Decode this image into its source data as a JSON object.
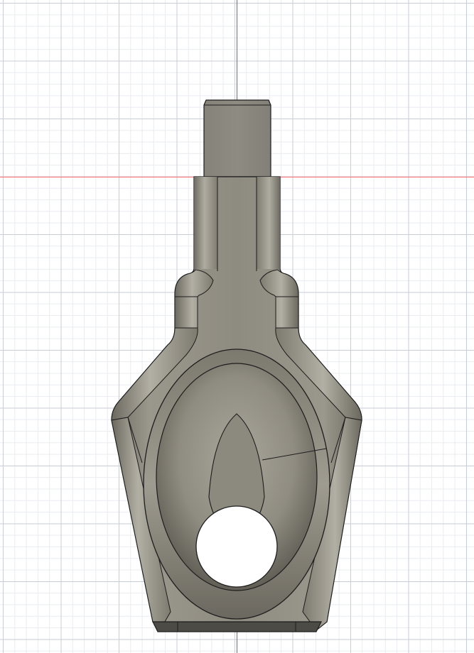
{
  "viewport": {
    "background": "#ffffff",
    "grid_major_color": "#c9ced6",
    "grid_minor_color": "#e9ecf0"
  },
  "axes": {
    "vertical_axis_color": "#4a68ff",
    "horizontal_axis_color": "#ff6b6b"
  },
  "model": {
    "body_color": "#8b887e",
    "body_light": "#a4a196",
    "body_dark": "#5f5c54",
    "edge_color": "#1d1d1d",
    "hole_color": "#ffffff"
  }
}
